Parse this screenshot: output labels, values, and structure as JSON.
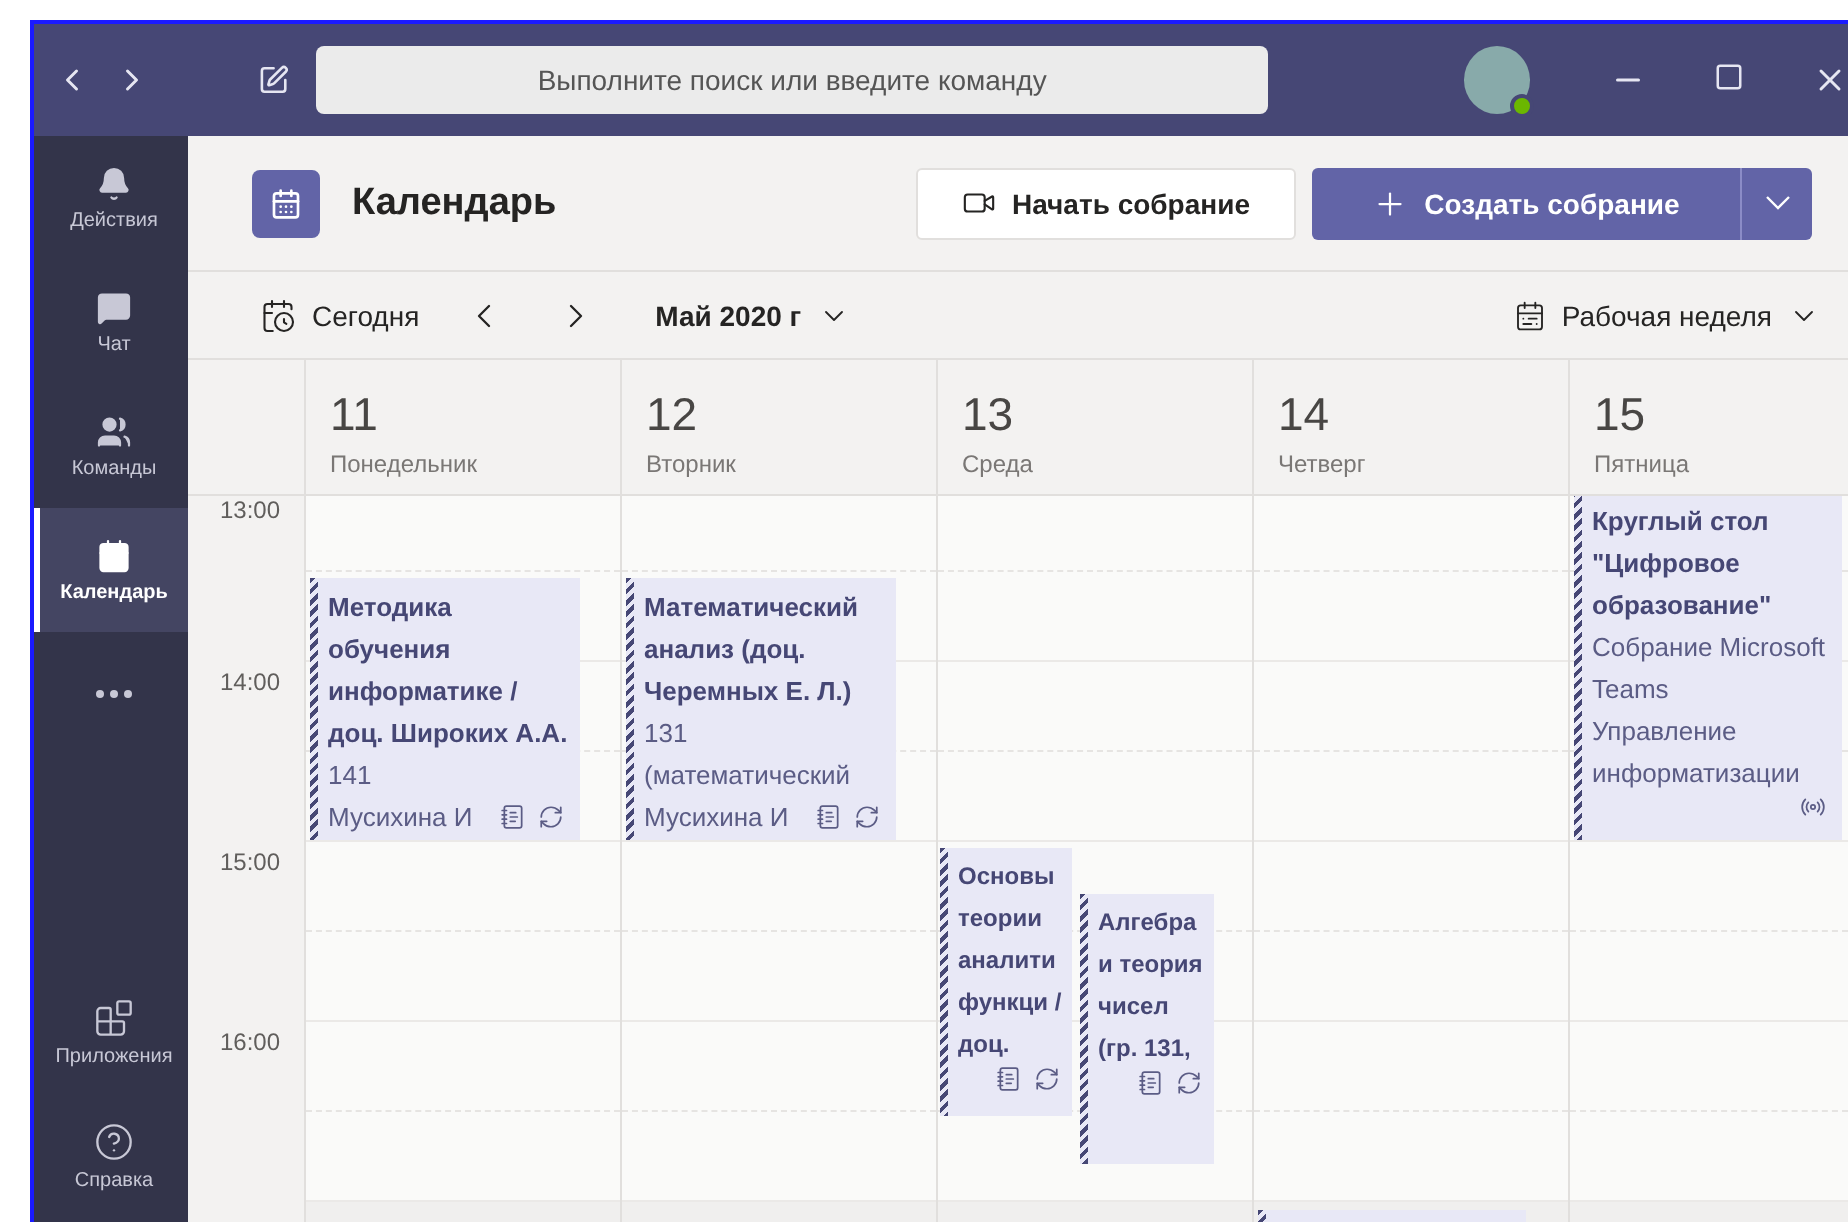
{
  "window": {
    "search": {
      "placeholder": "Выполните поиск или введите команду"
    }
  },
  "sidebar": {
    "items": [
      {
        "kind": "bell",
        "label": "Действия",
        "selected": false
      },
      {
        "kind": "chat",
        "label": "Чат",
        "selected": false
      },
      {
        "kind": "teams",
        "label": "Команды",
        "selected": false
      },
      {
        "kind": "calendar",
        "label": "Календарь",
        "selected": true
      },
      {
        "kind": "more",
        "selected": false
      }
    ],
    "bottom_items": [
      {
        "kind": "apps",
        "label": "Приложения"
      },
      {
        "kind": "help",
        "label": "Справка"
      }
    ]
  },
  "header": {
    "title": "Календарь",
    "start_meeting": "Начать собрание",
    "create_meeting": "Создать собрание"
  },
  "toolbar": {
    "today": "Сегодня",
    "month": "Май 2020 г",
    "view": "Рабочая неделя"
  },
  "times": [
    "13:00",
    "14:00",
    "15:00",
    "16:00"
  ],
  "days": [
    {
      "number": "11",
      "name": "Понедельник",
      "events": [
        {
          "kind": "lesson",
          "title": "Методика обучения информатике / доц. Широких А.А.",
          "lines": [
            "141"
          ],
          "last": "Мусихина И"
        }
      ]
    },
    {
      "number": "12",
      "name": "Вторник",
      "events": [
        {
          "kind": "lesson",
          "title": "Математический анализ (доц. Черемных Е. Л.)",
          "lines": [
            "131 (математический"
          ],
          "last": "Мусихина И"
        }
      ]
    },
    {
      "number": "13",
      "name": "Среда",
      "events": [
        {
          "kind": "lesson",
          "title": "Основы теории аналити функци / доц."
        },
        {
          "kind": "lesson",
          "title": "Алгебра и теория чисел (гр. 131,"
        }
      ]
    },
    {
      "number": "14",
      "name": "Четверг",
      "events": [
        {
          "kind": "partial"
        }
      ]
    },
    {
      "number": "15",
      "name": "Пятница",
      "events": [
        {
          "kind": "broadcast",
          "title": "Круглый стол \"Цифровое образование\"",
          "lines": [
            "Собрание Microsoft Teams",
            "Управление информатизации"
          ]
        }
      ]
    }
  ]
}
